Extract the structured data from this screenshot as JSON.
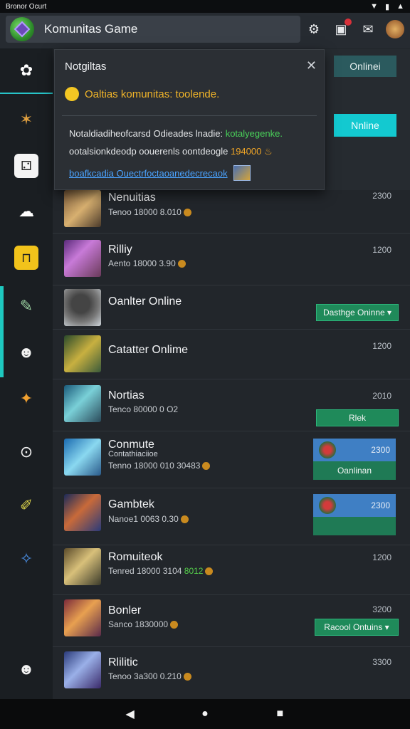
{
  "status_bar": {
    "left_text": "Bronor Ocurt",
    "wifi_icon": "wifi-icon",
    "battery_icon": "battery-icon",
    "signal_icon": "signal-icon"
  },
  "app_bar": {
    "title": "Komunitas Game"
  },
  "notification": {
    "title": "Notgiltas",
    "message": "Oaltias komunitas: toolende.",
    "body_line1_a": "Notaldiadiheofcarsd Odieades lnadie: ",
    "body_line1_b": "kotalyegenke.",
    "body_line2_a": "ootalsionkdeodp oouerenls oontdeogle ",
    "body_line2_b": "194000",
    "link_text": "boafkcadia Ouectrfoctaoanedecrecaok"
  },
  "online_buttons": {
    "first": "Onlinei",
    "second": "Nnline"
  },
  "rows": [
    {
      "title": "Nenuitias",
      "subtitle": "Tenoo 18000 8.010",
      "count": "2300"
    },
    {
      "title": "Rilliy",
      "subtitle": "Aento 18000 3.90",
      "count": "1200"
    },
    {
      "title": "Oanlter Online",
      "subtitle": "",
      "button": "Dasthge Oninne"
    },
    {
      "title": "Catatter Onlime",
      "subtitle": "",
      "count": "1200"
    },
    {
      "title": "Nortias",
      "subtitle": "Tenco 80000 0 O2",
      "count": "2010",
      "button": "Rlek"
    },
    {
      "title": "Conmute",
      "title2": "Contathiaciioe",
      "subtitle": "Tenno 18000 010 30483",
      "panel_num": "2300",
      "panel_label": "Oanlinan"
    },
    {
      "title": "Gambtek",
      "subtitle": "Nanoe1 0063 0.30",
      "panel_num": "2300",
      "panel_label": ""
    },
    {
      "title": "Romuiteok",
      "subtitle": "Tenred 18000 3104",
      "subtitle_green": "8012",
      "count": "1200"
    },
    {
      "title": "Bonler",
      "subtitle": "Sanco 1830000",
      "count": "3200",
      "button": "Racool Ontuins"
    },
    {
      "title": "Rlilitic",
      "subtitle": "Tenoo 3a300 0.210",
      "count": "3300"
    }
  ],
  "colors": {
    "accent": "#1ec9c0",
    "green": "#1f8a5a",
    "blue": "#3f7fc4",
    "warning": "#f0b429"
  }
}
